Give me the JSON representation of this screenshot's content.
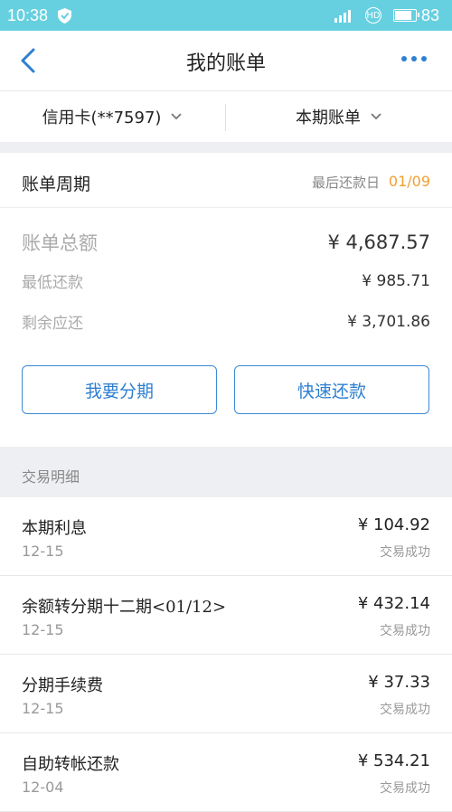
{
  "status_bar": {
    "time": "10:38",
    "battery": "83",
    "battery_level": 0.83,
    "hd_label": "HD"
  },
  "header": {
    "title": "我的账单"
  },
  "filters": {
    "card": "信用卡(**7597)",
    "period": "本期账单"
  },
  "cycle": {
    "label": "账单周期",
    "due_label": "最后还款日",
    "due_date": "01/09"
  },
  "summary": {
    "total_label": "账单总额",
    "total": "¥ 4,687.57",
    "min_label": "最低还款",
    "min": "¥ 985.71",
    "remain_label": "剩余应还",
    "remain": "¥ 3,701.86"
  },
  "actions": {
    "installment": "我要分期",
    "quick_pay": "快速还款"
  },
  "transactions_label": "交易明细",
  "transactions": [
    {
      "name": "本期利息",
      "date": "12-15",
      "amount": "¥ 104.92",
      "status": "交易成功"
    },
    {
      "name": "余额转分期十二期<01/12>",
      "date": "12-15",
      "amount": "¥ 432.14",
      "status": "交易成功"
    },
    {
      "name": "分期手续费",
      "date": "12-15",
      "amount": "¥ 37.33",
      "status": "交易成功"
    },
    {
      "name": "自助转帐还款",
      "date": "12-04",
      "amount": "¥ 534.21",
      "status": "交易成功"
    }
  ],
  "colors": {
    "status_bar": "#66d0e0",
    "accent": "#2e7fd1",
    "due_date": "#f0a030"
  }
}
